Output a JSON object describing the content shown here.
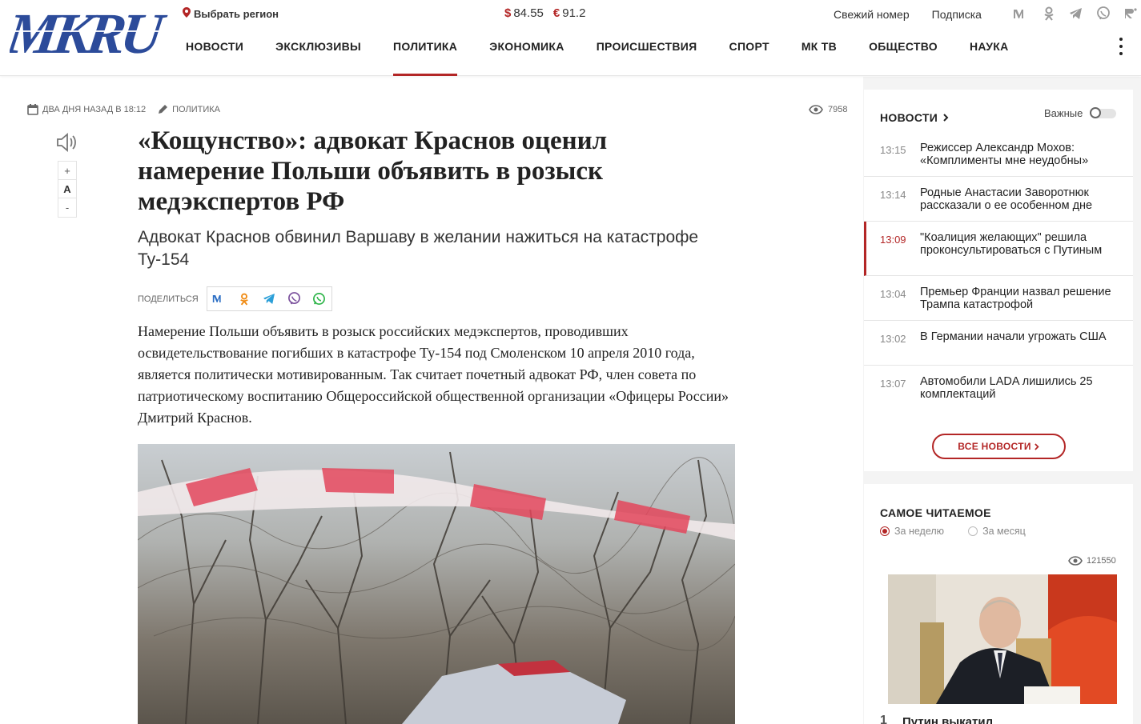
{
  "header": {
    "logo_text": "MKRU",
    "region": "Выбрать регион",
    "currency": [
      {
        "symbol": "$",
        "value": "84.55"
      },
      {
        "symbol": "€",
        "value": "91.2"
      }
    ],
    "links": [
      "Свежий номер",
      "Подписка"
    ],
    "nav": [
      "НОВОСТИ",
      "ЭКСКЛЮЗИВЫ",
      "ПОЛИТИКА",
      "ЭКОНОМИКА",
      "ПРОИСШЕСТВИЯ",
      "СПОРТ",
      "МК ТВ",
      "ОБЩЕСТВО",
      "НАУКА"
    ],
    "active_nav": "ПОЛИТИКА",
    "social_icons": [
      "vk-icon",
      "ok-icon",
      "telegram-icon",
      "viber-icon",
      "rutube-icon"
    ],
    "accent": "#b32626"
  },
  "article": {
    "date": "ДВА ДНЯ НАЗАД В 18:12",
    "rubric": "ПОЛИТИКА",
    "views": "7958",
    "font_controls": [
      "+",
      "A",
      "-"
    ],
    "title": "«Кощунство»: адвокат Краснов оценил намерение Польши объявить в розыск медэкспертов РФ",
    "subtitle": "Адвокат Краснов обвинил Варшаву в желании нажиться на катастрофе Ту-154",
    "share_label": "ПОДЕЛИТЬСЯ",
    "lead": "Намерение Польши объявить в розыск российских медэкспертов, проводивших освидетельствование погибших в катастрофе Ту-154 под Смоленском 10 апреля 2010 года, является политически мотивированным. Так считает почетный адвокат РФ, член совета по патриотическому воспитанию Общероссийской общественной организации «Офицеры России» Дмитрий Краснов."
  },
  "sidebar": {
    "news_title": "НОВОСТИ",
    "toggle_label": "Важные",
    "news": [
      {
        "time": "13:15",
        "text": "Режиссер Александр Мохов: «Комплименты мне неудобны»"
      },
      {
        "time": "13:14",
        "text": "Родные Анастасии Заворотнюк рассказали о ее особенном дне"
      },
      {
        "time": "13:09",
        "text": "\"Коалиция желающих\" решила проконсультироваться с Путиным"
      },
      {
        "time": "13:04",
        "text": "Премьер Франции назвал решение Трампа катастрофой"
      },
      {
        "time": "13:02",
        "text": "В Германии начали угрожать США"
      },
      {
        "time": "13:07",
        "text": "Автомобили LADA лишились 25 комплектаций"
      }
    ],
    "all_news": "ВСЕ НОВОСТИ",
    "popular_title": "САМОЕ ЧИТАЕМОЕ",
    "popular_tabs": [
      "За неделю",
      "За месяц"
    ],
    "popular_views": "121550",
    "popular_item_num": "1",
    "popular_item_title": "Путин выкатил"
  }
}
